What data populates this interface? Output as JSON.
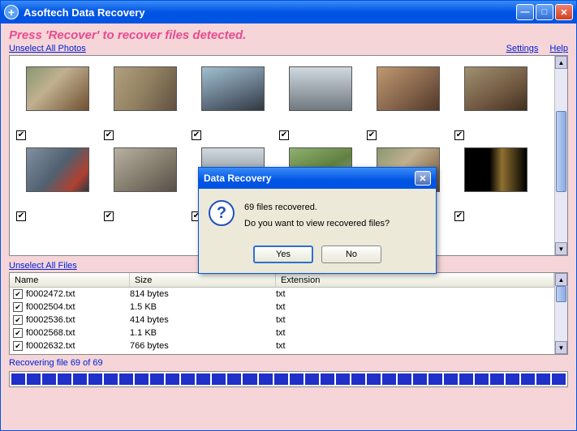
{
  "window": {
    "title": "Asoftech Data Recovery"
  },
  "instruction": "Press 'Recover' to recover files detected.",
  "links": {
    "unselect_photos": "Unselect All Photos",
    "unselect_files": "Unselect All Files",
    "settings": "Settings",
    "help": "Help"
  },
  "photos": {
    "count": 12
  },
  "file_table": {
    "headers": {
      "name": "Name",
      "size": "Size",
      "ext": "Extension"
    },
    "rows": [
      {
        "name": "f0002472.txt",
        "size": "814 bytes",
        "ext": "txt"
      },
      {
        "name": "f0002504.txt",
        "size": "1.5 KB",
        "ext": "txt"
      },
      {
        "name": "f0002536.txt",
        "size": "414 bytes",
        "ext": "txt"
      },
      {
        "name": "f0002568.txt",
        "size": "1.1 KB",
        "ext": "txt"
      },
      {
        "name": "f0002632.txt",
        "size": "766 bytes",
        "ext": "txt"
      }
    ]
  },
  "status": "Recovering file 69 of 69",
  "progress": {
    "segments": 36,
    "filled": 36
  },
  "dialog": {
    "title": "Data Recovery",
    "line1": "69 files recovered.",
    "line2": "Do you want to view recovered files?",
    "yes": "Yes",
    "no": "No"
  }
}
